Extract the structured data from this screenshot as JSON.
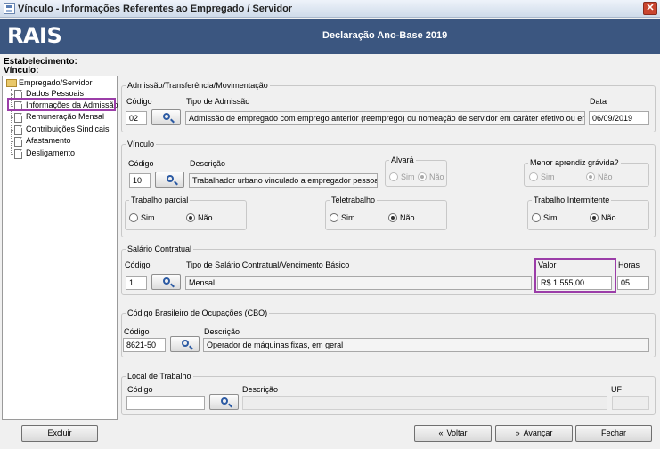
{
  "window": {
    "title": "Vínculo - Informações Referentes ao Empregado / Servidor",
    "close": "✕"
  },
  "banner": {
    "logo": "RAIS",
    "title": "Declaração Ano-Base 2019"
  },
  "labels": {
    "estabelecimento": "Estabelecimento:",
    "vinculo": "Vínculo:"
  },
  "tree": {
    "root": "Empregado/Servidor",
    "items": [
      "Dados Pessoais",
      "Informações da Admissão",
      "Remuneração Mensal",
      "Contribuições Sindicais",
      "Afastamento",
      "Desligamento"
    ],
    "selected": "Informações da Admissão"
  },
  "admissao": {
    "legend": "Admissão/Transferência/Movimentação",
    "codigo_label": "Código",
    "tipo_label": "Tipo de Admissão",
    "data_label": "Data",
    "codigo": "02",
    "tipo": "Admissão de empregado com emprego anterior (reemprego) ou nomeação de servidor em caráter efetivo ou em comissão",
    "data": "06/09/2019"
  },
  "vinculo": {
    "legend": "Vínculo",
    "codigo_label": "Código",
    "descricao_label": "Descrição",
    "codigo": "10",
    "descricao": "Trabalhador urbano vinculado a empregador pessoa jurídica",
    "alvara": {
      "legend": "Alvará",
      "sim": "Sim",
      "nao": "Não",
      "selected": "Não"
    },
    "menor": {
      "legend": "Menor aprendiz grávida?",
      "sim": "Sim",
      "nao": "Não",
      "selected": "Não"
    },
    "parcial": {
      "legend": "Trabalho parcial",
      "sim": "Sim",
      "nao": "Não",
      "selected": "Não"
    },
    "teletrabalho": {
      "legend": "Teletrabalho",
      "sim": "Sim",
      "nao": "Não",
      "selected": "Não"
    },
    "intermitente": {
      "legend": "Trabalho Intermitente",
      "sim": "Sim",
      "nao": "Não",
      "selected": "Não"
    }
  },
  "salario": {
    "legend": "Salário Contratual",
    "codigo_label": "Código",
    "tipo_label": "Tipo de Salário Contratual/Vencimento Básico",
    "valor_label": "Valor",
    "horas_label": "Horas",
    "codigo": "1",
    "tipo": "Mensal",
    "valor": "R$ 1.555,00",
    "horas": "05"
  },
  "cbo": {
    "legend": "Código Brasileiro de Ocupações (CBO)",
    "codigo_label": "Código",
    "descricao_label": "Descrição",
    "codigo": "8621-50",
    "descricao": "Operador de máquinas fixas, em geral"
  },
  "local": {
    "legend": "Local de Trabalho",
    "codigo_label": "Código",
    "descricao_label": "Descrição",
    "uf_label": "UF",
    "codigo": "",
    "descricao": "",
    "uf": ""
  },
  "buttons": {
    "excluir": "Excluir",
    "voltar": "Voltar",
    "avancar": "Avançar",
    "fechar": "Fechar",
    "voltar_icon": "«",
    "avancar_icon": "»"
  }
}
